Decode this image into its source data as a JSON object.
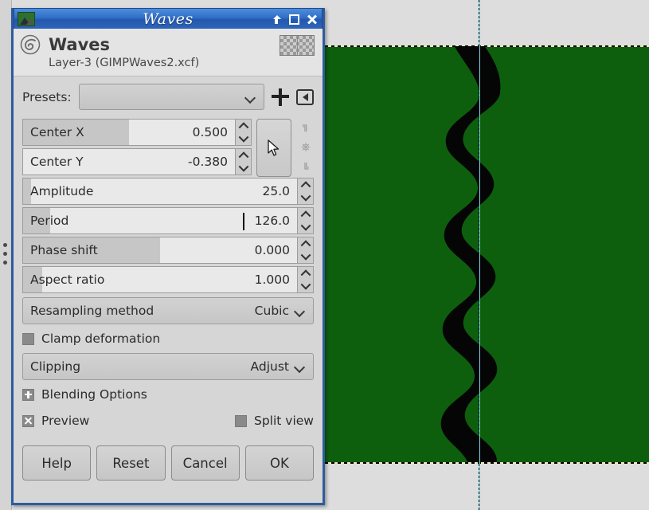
{
  "window": {
    "title": "Waves",
    "app_icon": "gimp-wilber-icon",
    "buttons": [
      {
        "name": "shade-button",
        "label": "Shade"
      },
      {
        "name": "maximize-button",
        "label": "Maximize"
      },
      {
        "name": "close-button",
        "label": "Close"
      }
    ]
  },
  "header": {
    "logo": "gimp-logo-icon",
    "title": "Waves",
    "subtitle": "Layer-3 (GIMPWaves2.xcf)",
    "thumbnail": "layer-transparency-thumbnail"
  },
  "presets": {
    "label": "Presets:",
    "value": "",
    "add_icon": "plus-icon",
    "menu_icon": "preset-menu-icon"
  },
  "parameters": [
    {
      "name": "center-x",
      "label": "Center X",
      "value": "0.500",
      "fill_pct": 50,
      "caret": false
    },
    {
      "name": "center-y",
      "label": "Center Y",
      "value": "-0.380",
      "fill_pct": 0,
      "caret": false
    },
    {
      "name": "amplitude",
      "label": "Amplitude",
      "value": "25.0",
      "fill_pct": 3,
      "caret": false
    },
    {
      "name": "period",
      "label": "Period",
      "value": "126.0",
      "fill_pct": 10,
      "caret": true
    },
    {
      "name": "phase-shift",
      "label": "Phase shift",
      "value": "0.000",
      "fill_pct": 50,
      "caret": false
    },
    {
      "name": "aspect-ratio",
      "label": "Aspect ratio",
      "value": "1.000",
      "fill_pct": 7,
      "caret": false
    }
  ],
  "center_tools": {
    "picker_icon": "pointer-picker-icon",
    "chain_icon": "broken-chain-icon"
  },
  "combos": [
    {
      "name": "resampling-method",
      "label": "Resampling method",
      "value": "Cubic",
      "chevron": "chevron-down-icon"
    },
    {
      "name": "clipping",
      "label": "Clipping",
      "value": "Adjust",
      "chevron": "chevron-down-icon"
    }
  ],
  "checks": {
    "clamp_deformation": {
      "label": "Clamp deformation",
      "checked": false
    },
    "blending_options": {
      "label": "Blending Options",
      "expanded": false
    },
    "preview": {
      "label": "Preview",
      "checked": true
    },
    "split_view": {
      "label": "Split view",
      "checked": false
    }
  },
  "buttons": [
    {
      "name": "help-button",
      "label": "Help"
    },
    {
      "name": "reset-button",
      "label": "Reset"
    },
    {
      "name": "cancel-button",
      "label": "Cancel"
    },
    {
      "name": "ok-button",
      "label": "OK"
    }
  ],
  "canvas": {
    "layer_color": "#0d5f0d",
    "wave_color": "#050505",
    "guide_color": "#7fd8e8",
    "background_color": "#dddddd"
  }
}
